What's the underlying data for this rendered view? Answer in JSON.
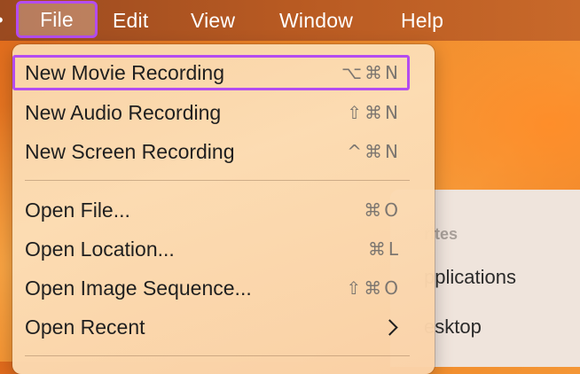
{
  "menubar": {
    "items": [
      {
        "label": "File"
      },
      {
        "label": "Edit"
      },
      {
        "label": "View"
      },
      {
        "label": "Window"
      },
      {
        "label": "Help"
      }
    ]
  },
  "file_menu": {
    "items": [
      {
        "label": "New Movie Recording",
        "shortcut": "⌥⌘N"
      },
      {
        "label": "New Audio Recording",
        "shortcut": "⇧⌘N"
      },
      {
        "label": "New Screen Recording",
        "shortcut": "^⌘N"
      },
      {
        "label": "Open File...",
        "shortcut": "⌘O"
      },
      {
        "label": "Open Location...",
        "shortcut": "⌘L"
      },
      {
        "label": "Open Image Sequence...",
        "shortcut": "⇧⌘O"
      },
      {
        "label": "Open Recent",
        "submenu_icon": "chevron-right-icon"
      }
    ]
  },
  "finder": {
    "section_label": "rites",
    "items": [
      {
        "label": "pplications"
      },
      {
        "label": "esktop"
      }
    ]
  },
  "colors": {
    "highlight_outline": "#b44cf0",
    "menubar_bg": "#b85a22",
    "menu_bg": "#fcdeb6"
  }
}
